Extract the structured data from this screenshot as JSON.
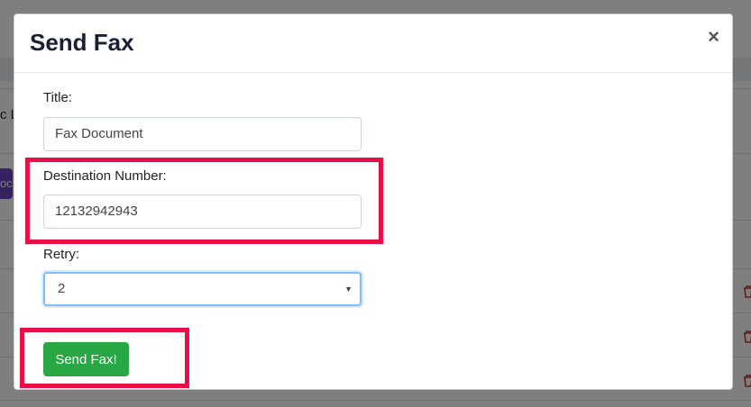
{
  "background": {
    "partial_text": "c Li",
    "partial_button": "oc"
  },
  "modal": {
    "title": "Send Fax",
    "close_label": "×",
    "title_label": "Title:",
    "title_value": "Fax Document",
    "destination_label": "Destination Number:",
    "destination_value": "12132942943",
    "retry_label": "Retry:",
    "retry_value": "2",
    "send_label": "Send Fax!"
  },
  "colors": {
    "highlight": "#ea1046",
    "send_button": "#28a745",
    "select_focus": "#80bdff"
  }
}
